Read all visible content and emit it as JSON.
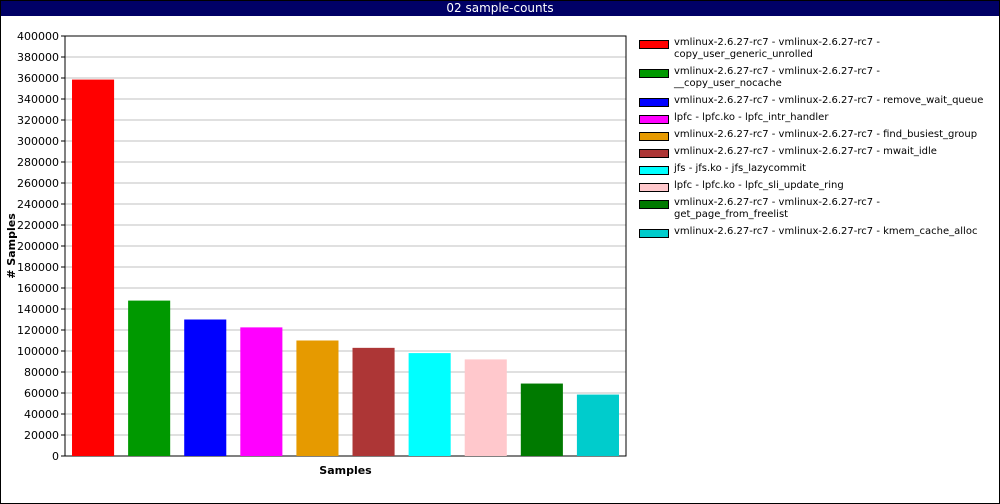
{
  "window": {
    "title": "02 sample-counts"
  },
  "chart_data": {
    "type": "bar",
    "title": "",
    "xlabel": "Samples",
    "ylabel": "# Samples",
    "ylim": [
      0,
      400000
    ],
    "yticks": [
      "0",
      "20000",
      "40000",
      "60000",
      "80000",
      "100000",
      "120000",
      "140000",
      "160000",
      "180000",
      "200000",
      "220000",
      "240000",
      "260000",
      "280000",
      "300000",
      "320000",
      "340000",
      "360000",
      "380000",
      "400000"
    ],
    "grid": true,
    "legend_position": "right",
    "series": [
      {
        "name": "vmlinux-2.6.27-rc7 - vmlinux-2.6.27-rc7 -\ncopy_user_generic_unrolled",
        "value": 358500,
        "color": "#ff0000"
      },
      {
        "name": "vmlinux-2.6.27-rc7 - vmlinux-2.6.27-rc7 -\n__copy_user_nocache",
        "value": 148000,
        "color": "#009900"
      },
      {
        "name": "vmlinux-2.6.27-rc7 - vmlinux-2.6.27-rc7 - remove_wait_queue",
        "value": 130000,
        "color": "#0000ff"
      },
      {
        "name": "lpfc - lpfc.ko - lpfc_intr_handler",
        "value": 122500,
        "color": "#ff00ff"
      },
      {
        "name": "vmlinux-2.6.27-rc7 - vmlinux-2.6.27-rc7 - find_busiest_group",
        "value": 110000,
        "color": "#e69a00"
      },
      {
        "name": "vmlinux-2.6.27-rc7 - vmlinux-2.6.27-rc7 - mwait_idle",
        "value": 103000,
        "color": "#ad3636"
      },
      {
        "name": "jfs - jfs.ko - jfs_lazycommit",
        "value": 98000,
        "color": "#00ffff"
      },
      {
        "name": "lpfc - lpfc.ko - lpfc_sli_update_ring",
        "value": 92000,
        "color": "#ffc8cc"
      },
      {
        "name": "vmlinux-2.6.27-rc7 - vmlinux-2.6.27-rc7 -\nget_page_from_freelist",
        "value": 69000,
        "color": "#007a00"
      },
      {
        "name": "vmlinux-2.6.27-rc7 - vmlinux-2.6.27-rc7 - kmem_cache_alloc",
        "value": 58500,
        "color": "#00cccc"
      }
    ]
  }
}
